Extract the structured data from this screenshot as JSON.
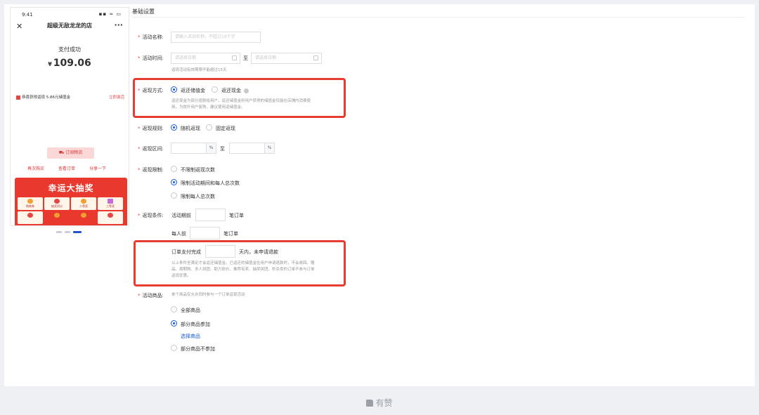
{
  "phone": {
    "time": "9:41",
    "signal": "▪▪ ≈ ▭",
    "title": "超级无敌龙龙的店",
    "pay_status": "支付成功",
    "currency": "¥",
    "amount": "109.06",
    "rebate_text": "恭喜获得返现 5.86元储值金",
    "rebate_link": "立即激活",
    "logistics_btn": "订阅物流",
    "actions": [
      "再次购买",
      "查看订单",
      "分享一下"
    ],
    "banner_title": "幸运大抽奖",
    "banner_cells": [
      "购物券",
      "抽奖积分",
      "二等奖",
      "三等奖",
      "",
      "",
      "",
      ""
    ]
  },
  "section_title": "基础设置",
  "form": {
    "activity_name": {
      "label": "活动名称:",
      "placeholder": "请输入活动名称，不超过10个字"
    },
    "activity_time": {
      "label": "活动时间:",
      "start_placeholder": "请选择日期",
      "separator": "至",
      "end_placeholder": "请选择日期",
      "hint": "返现活动有效期限不能超过15天"
    },
    "return_method": {
      "label": "返现方式:",
      "options": [
        "返还储值金",
        "返还现金"
      ],
      "selected": 0,
      "hint_line1": "返还现金为部分退款给用户，返还储值金则用户获得的储值金仅能在店铺内消费使",
      "hint_line2": "用，为提升用户复购，建议使用返储值金。"
    },
    "return_rule": {
      "label": "返现规则:",
      "options": [
        "随机返现",
        "固定返现"
      ],
      "selected": 0
    },
    "return_range": {
      "label": "返现区间:",
      "unit": "%",
      "separator": "至"
    },
    "return_limit": {
      "label": "返现限制:",
      "options": [
        "不限制返现次数",
        "限制活动期间和每人总次数",
        "限制每人总次数"
      ],
      "selected": 1
    },
    "return_condition": {
      "label": "返现条件:",
      "prefix1": "活动期前",
      "suffix1": "笔订单",
      "prefix2": "每人前",
      "suffix2": "笔订单",
      "prefix3": "订单支付完成",
      "suffix3": "天内，未申请退款",
      "hint_line1": "以上条件全满足才会返还储值金。已返还的储值金在用户申请退款时，不会收回。赠",
      "hint_line2": "品、周期购、多人拼团、助力砍价、推荐有奖、抽奖拼团、秒杀类的订单不参与订单",
      "hint_line3": "返现优惠。"
    },
    "activity_goods": {
      "label": "活动商品:",
      "hint": "单个商品仅允许同时参与一个订单返现活动",
      "options": [
        "全部商品",
        "部分商品参加",
        "部分商品不参加"
      ],
      "selected": 1,
      "select_link": "选择商品"
    }
  },
  "footer": {
    "brand": "有赞"
  },
  "colors": {
    "accent": "#155bd4",
    "highlight_border": "#e63c31",
    "required": "#e54545"
  }
}
